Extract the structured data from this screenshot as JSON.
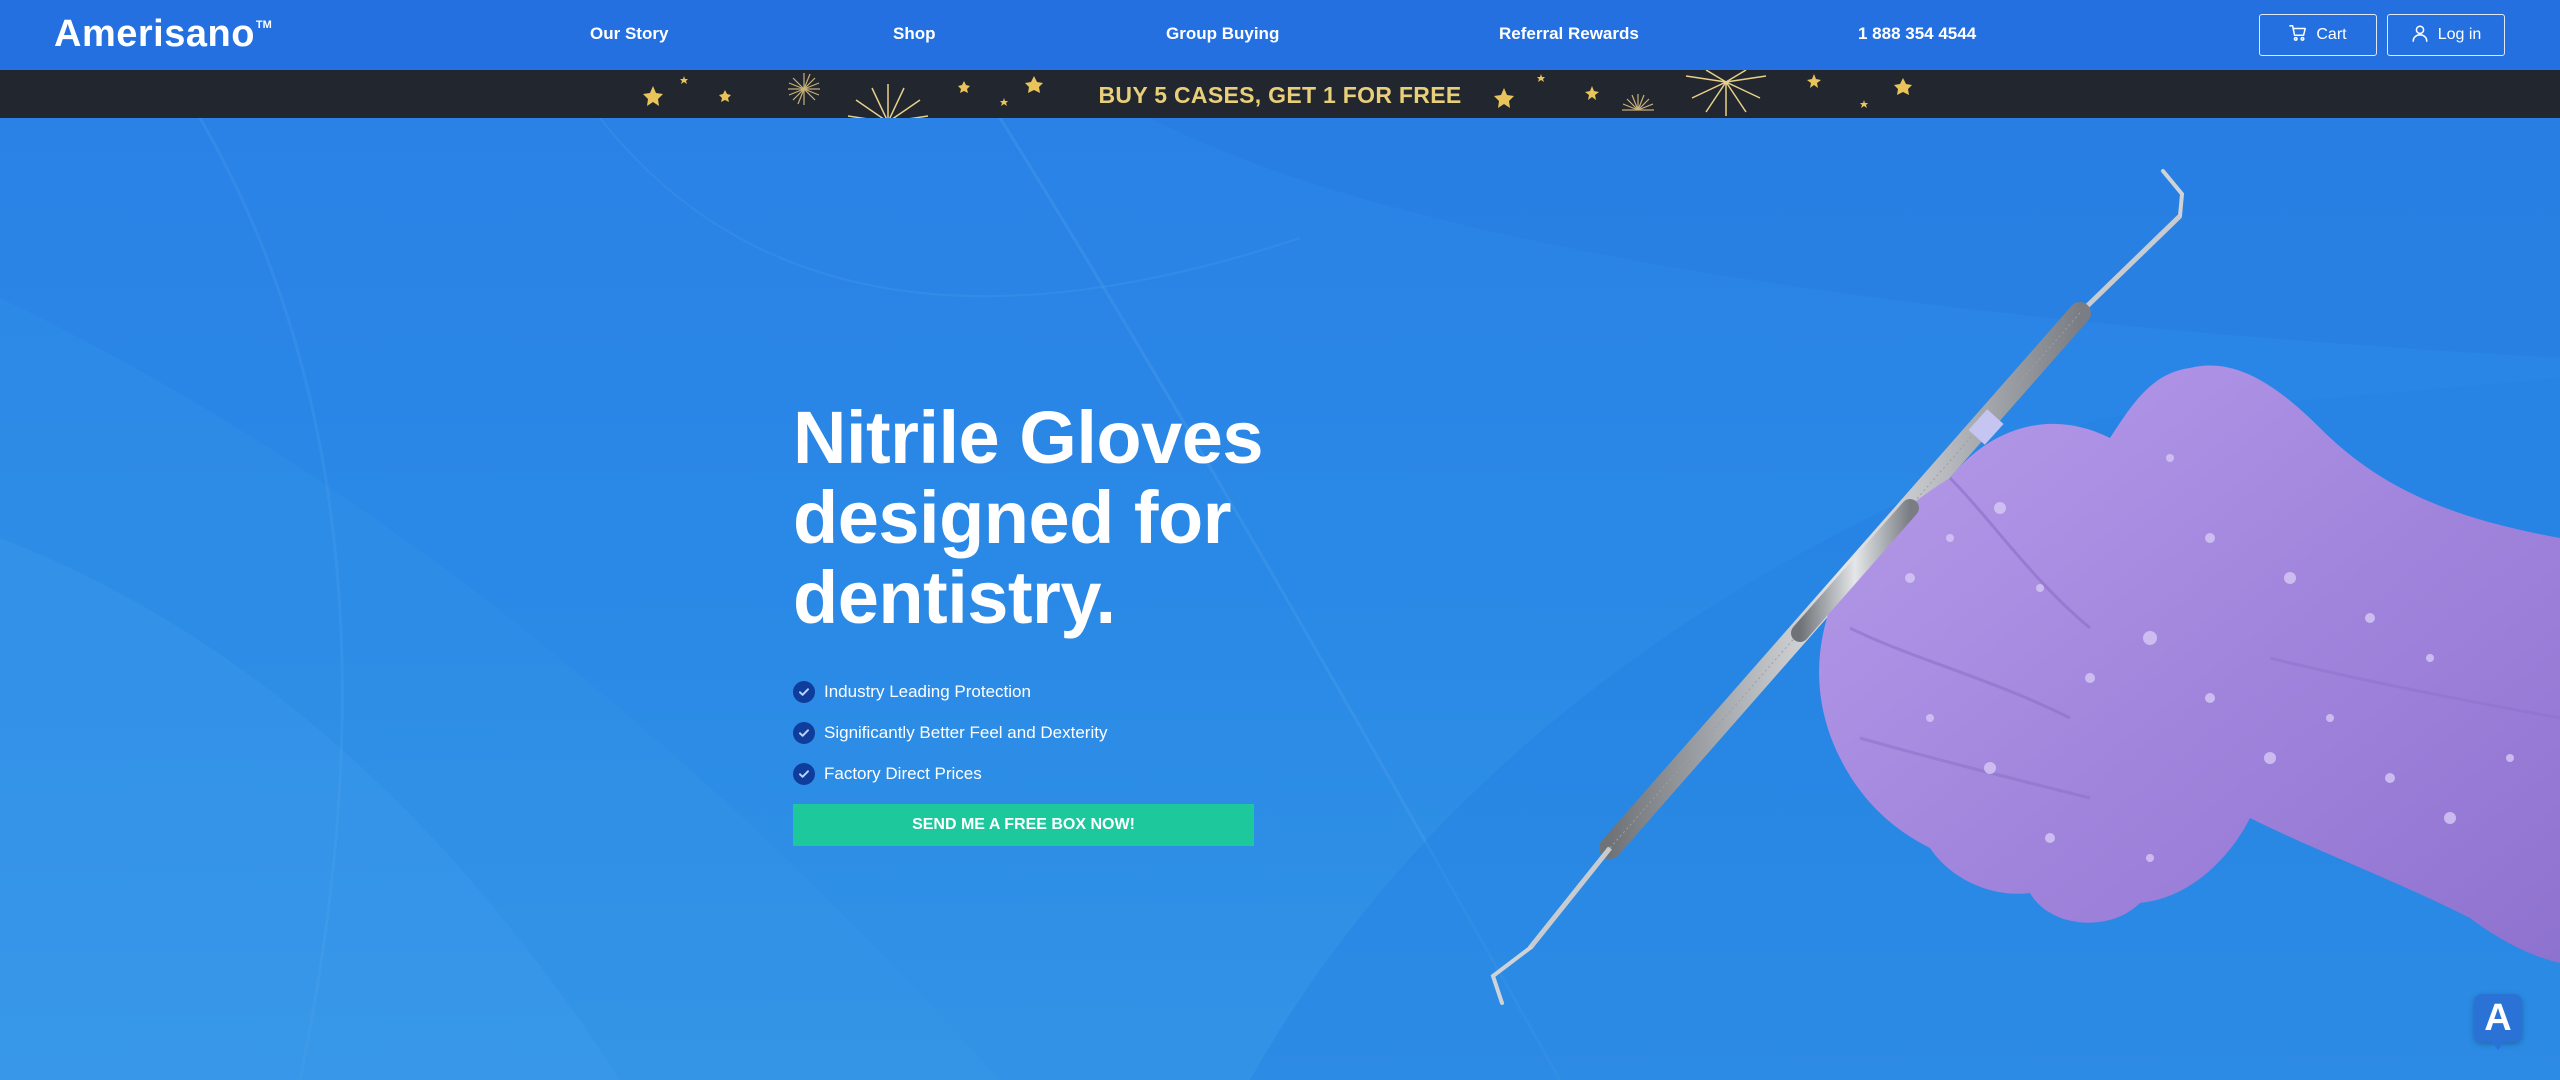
{
  "header": {
    "logo": "Amerisano",
    "logo_mark": "TM",
    "nav": [
      {
        "label": "Our Story"
      },
      {
        "label": "Shop"
      },
      {
        "label": "Group Buying"
      },
      {
        "label": "Referral Rewards"
      },
      {
        "label": "1 888 354 4544"
      }
    ],
    "cart_label": "Cart",
    "cart_icon": "cart-icon",
    "login_label": "Log in",
    "login_icon": "user-icon"
  },
  "promo": {
    "text": "BUY 5 CASES, GET 1 FOR FREE",
    "text_color": "#e8cf7a",
    "background": "#22262e"
  },
  "hero": {
    "headline_lines": [
      "Nitrile Gloves",
      "designed for",
      "dentistry."
    ],
    "features": [
      {
        "label": "Industry Leading Protection",
        "icon": "check-icon"
      },
      {
        "label": "Significantly Better Feel and Dexterity",
        "icon": "check-icon"
      },
      {
        "label": "Factory Direct Prices",
        "icon": "check-icon"
      }
    ],
    "cta_label": "SEND ME A FREE BOX NOW!",
    "cta_color": "#1ec89d",
    "image": "purple-gloved-hand-holding-dental-tool"
  },
  "chat_widget": {
    "label": "A"
  },
  "colors": {
    "header": "#2570e0",
    "hero": "#2a86e3",
    "check": "#0f3d9c",
    "glove": "#a98ae0"
  }
}
